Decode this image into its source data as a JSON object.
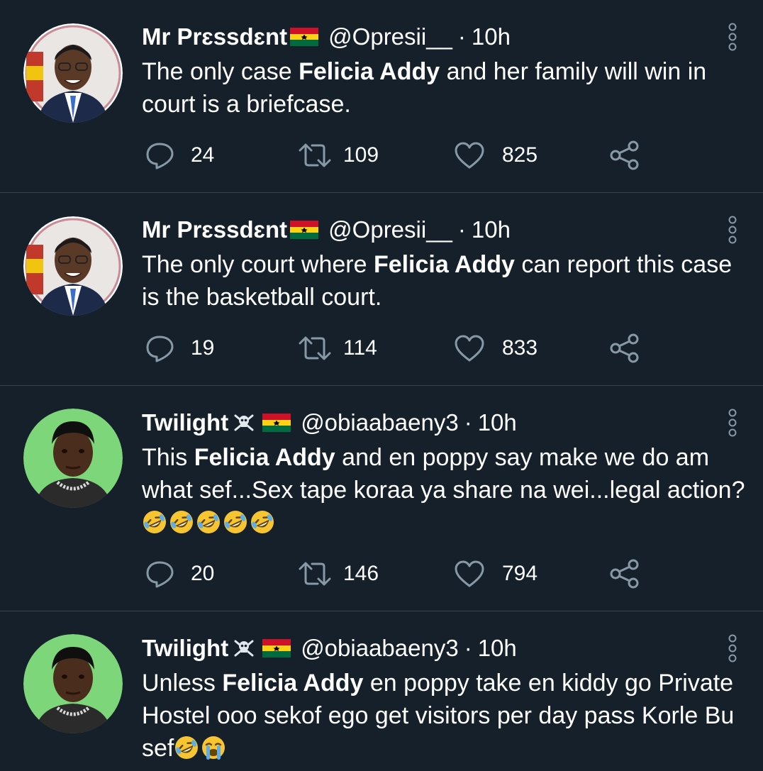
{
  "colors": {
    "background": "#15202b",
    "divider": "#38444d",
    "text": "#ffffff",
    "icon": "#8899a6"
  },
  "tweets": [
    {
      "name": "Mr Prɛssdɛnt",
      "flag": "ghana-flag",
      "handle": "@Opresii__",
      "dot": "·",
      "time": "10h",
      "text_parts": [
        "The only case ",
        "Felicia Addy",
        " and her family will win in court is a briefcase."
      ],
      "replies": "24",
      "retweets": "109",
      "likes": "825"
    },
    {
      "name": "Mr Prɛssdɛnt",
      "flag": "ghana-flag",
      "handle": "@Opresii__",
      "dot": "·",
      "time": "10h",
      "text_parts": [
        "The only court where ",
        "Felicia Addy",
        " can report this case is the basketball court."
      ],
      "replies": "19",
      "retweets": "114",
      "likes": "833"
    },
    {
      "name": "Twilight",
      "flag": "ghana-flag",
      "handle": "@obiaabaeny3",
      "dot": "·",
      "time": "10h",
      "text_parts": [
        "This ",
        "Felicia Addy",
        " and en poppy say make we do am what sef...Sex tape koraa ya share na wei...legal action?"
      ],
      "emojis": [
        "rolling-laughing-emoji",
        "rolling-laughing-emoji",
        "rolling-laughing-emoji",
        "rolling-laughing-emoji",
        "rolling-laughing-emoji"
      ],
      "replies": "20",
      "retweets": "146",
      "likes": "794"
    },
    {
      "name": "Twilight",
      "flag": "ghana-flag",
      "handle": "@obiaabaeny3",
      "dot": "·",
      "time": "10h",
      "text_parts": [
        "Unless ",
        "Felicia Addy",
        " en poppy take en kiddy go Private Hostel ooo sekof ego get visitors per day pass Korle Bu sef"
      ],
      "emojis": [
        "rolling-laughing-emoji",
        "crying-emoji"
      ]
    }
  ]
}
